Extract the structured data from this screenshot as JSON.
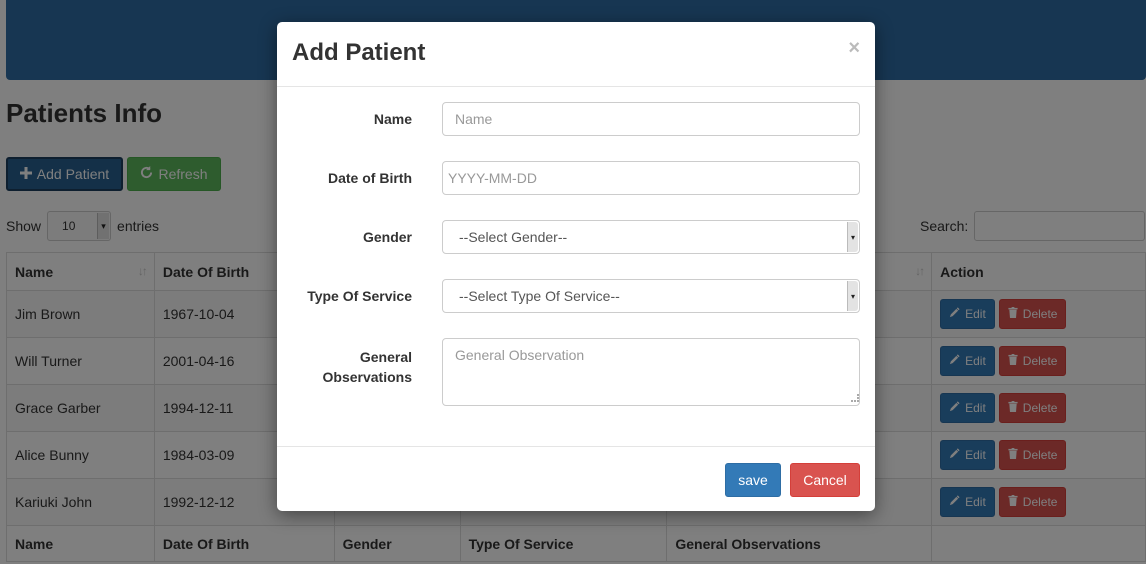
{
  "page": {
    "title": "Patients Info"
  },
  "toolbar": {
    "add_label": "Add Patient",
    "refresh_label": "Refresh"
  },
  "table_controls": {
    "show_label": "Show",
    "entries_value": "10",
    "entries_label": "entries",
    "search_label": "Search:"
  },
  "table": {
    "headers": [
      "Name",
      "Date Of Birth",
      "Gender",
      "Type Of Service",
      "General Observations",
      "Action"
    ],
    "rows": [
      {
        "name": "Jim Brown",
        "dob": "1967-10-04"
      },
      {
        "name": "Will Turner",
        "dob": "2001-04-16"
      },
      {
        "name": "Grace Garber",
        "dob": "1994-12-11"
      },
      {
        "name": "Alice Bunny",
        "dob": "1984-03-09"
      },
      {
        "name": "Kariuki John",
        "dob": "1992-12-12"
      }
    ],
    "edit_label": "Edit",
    "delete_label": "Delete"
  },
  "modal": {
    "title": "Add Patient",
    "close_glyph": "×",
    "fields": {
      "name": {
        "label": "Name",
        "placeholder": "Name"
      },
      "dob": {
        "label": "Date of Birth",
        "placeholder": "YYYY-MM-DD"
      },
      "gender": {
        "label": "Gender",
        "selected": "--Select Gender--"
      },
      "service": {
        "label": "Type Of Service",
        "selected": "--Select Type Of Service--"
      },
      "observations": {
        "label_line1": "General",
        "label_line2": "Observations",
        "placeholder": "General Observation"
      }
    },
    "save_label": "save",
    "cancel_label": "Cancel"
  },
  "colors": {
    "primary": "#337ab7",
    "success": "#5cb85c",
    "danger": "#d9534f",
    "header_bar": "#2e6da4"
  },
  "icons": [
    "plus-icon",
    "refresh-icon",
    "pencil-icon",
    "trash-icon",
    "sort-icon",
    "close-icon"
  ]
}
